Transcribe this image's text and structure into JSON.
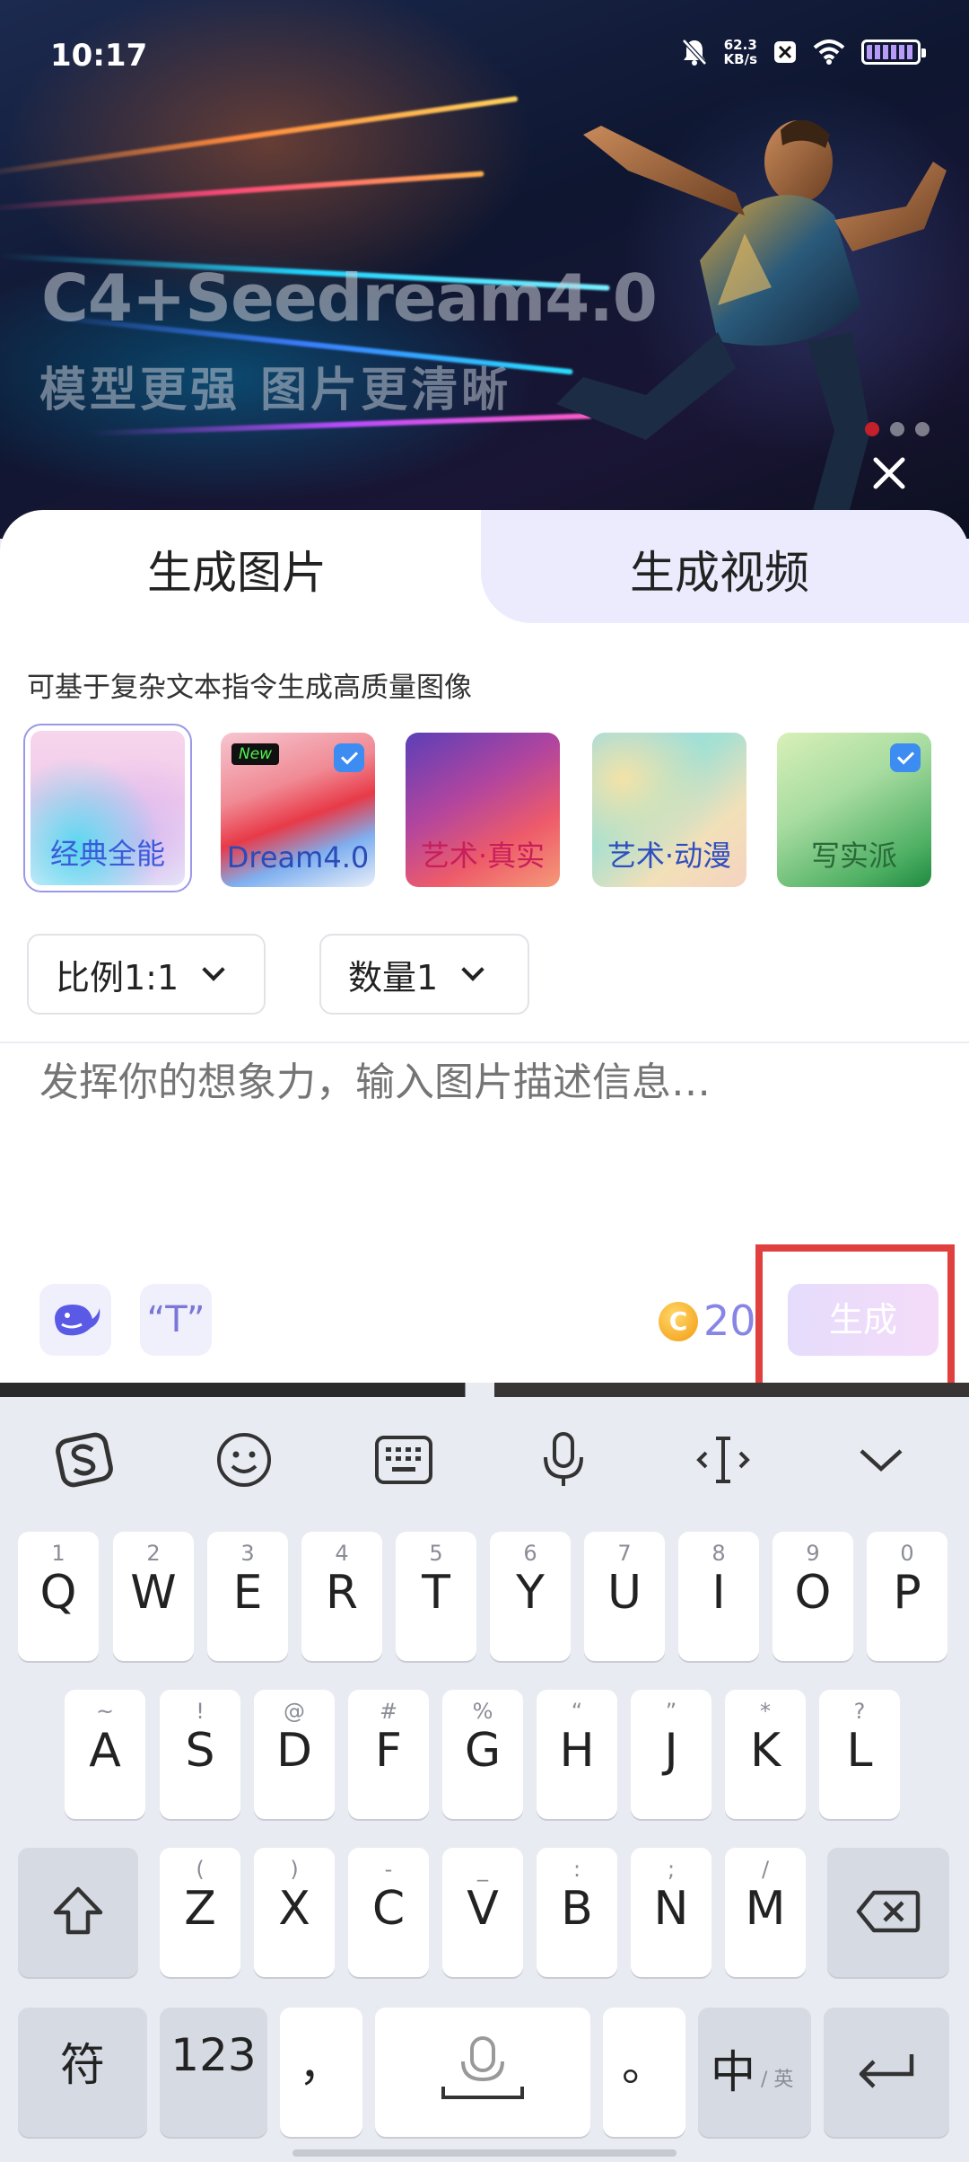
{
  "status": {
    "time": "10:17",
    "net_speed": "62.3",
    "net_unit": "KB/s",
    "icons": [
      "bell-off-icon",
      "x-app-icon",
      "wifi-icon",
      "battery-icon"
    ]
  },
  "banner": {
    "title": "C4+Seedream4.0",
    "subtitle": "模型更强 图片更清晰",
    "page_count": 3,
    "active_page": 1
  },
  "tabs": [
    {
      "label": "生成图片",
      "selected": true
    },
    {
      "label": "生成视频",
      "selected": false
    }
  ],
  "description": "可基于复杂文本指令生成高质量图像",
  "models": [
    {
      "label": "经典全能",
      "selected": true,
      "badge": ""
    },
    {
      "label": "Dream4.0",
      "selected": false,
      "badge": "New",
      "vip": true
    },
    {
      "label": "艺术·真实",
      "selected": false,
      "badge": ""
    },
    {
      "label": "艺术·动漫",
      "selected": false,
      "badge": ""
    },
    {
      "label": "写实派",
      "selected": false,
      "badge": "",
      "vip": true
    }
  ],
  "options": {
    "ratio_label": "比例1:1",
    "count_label": "数量1"
  },
  "prompt": {
    "placeholder": "发挥你的想象力，输入图片描述信息…",
    "value": ""
  },
  "tools": {
    "quote_label": "“T”"
  },
  "cost": "20",
  "generate_label": "生成",
  "keyboard": {
    "row1": [
      [
        "1",
        "Q"
      ],
      [
        "2",
        "W"
      ],
      [
        "3",
        "E"
      ],
      [
        "4",
        "R"
      ],
      [
        "5",
        "T"
      ],
      [
        "6",
        "Y"
      ],
      [
        "7",
        "U"
      ],
      [
        "8",
        "I"
      ],
      [
        "9",
        "O"
      ],
      [
        "0",
        "P"
      ]
    ],
    "row2": [
      [
        "~",
        "A"
      ],
      [
        "!",
        "S"
      ],
      [
        "@",
        "D"
      ],
      [
        "#",
        "F"
      ],
      [
        "%",
        "G"
      ],
      [
        "“",
        "H"
      ],
      [
        "”",
        "J"
      ],
      [
        "*",
        "K"
      ],
      [
        "?",
        "L"
      ]
    ],
    "row3": [
      [
        "(",
        "Z"
      ],
      [
        ")",
        "X"
      ],
      [
        "-",
        "C"
      ],
      [
        "_",
        "V"
      ],
      [
        ":",
        "B"
      ],
      [
        ";",
        "N"
      ],
      [
        "/",
        "M"
      ]
    ],
    "symbols": "符",
    "numbers": "123",
    "comma": "，",
    "period": "。",
    "lang_main": "中",
    "lang_sub": "/ 英"
  }
}
